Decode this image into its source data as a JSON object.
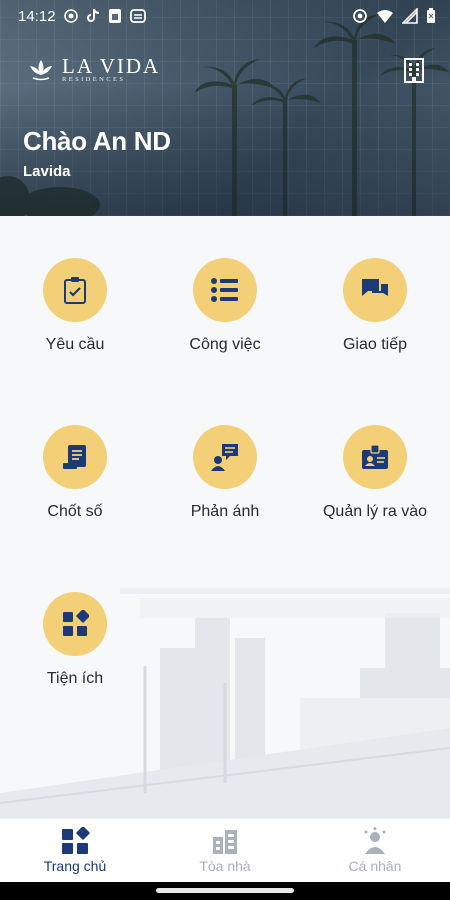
{
  "status_bar": {
    "time": "14:12",
    "left_icons": [
      "record-icon",
      "tiktok-icon",
      "sim-card-icon",
      "cast-icon"
    ],
    "right_icons": [
      "eye-icon",
      "wifi-icon",
      "signal-icon",
      "battery-icon"
    ]
  },
  "header": {
    "logo_text": "LA VIDA",
    "logo_subtext": "RESIDENCES",
    "greeting": "Chào An ND",
    "project_name": "Lavida",
    "building_icon": "building-icon"
  },
  "menu": {
    "items": [
      {
        "label": "Yêu cầu",
        "icon": "clipboard-check-icon"
      },
      {
        "label": "Công việc",
        "icon": "task-list-icon"
      },
      {
        "label": "Giao tiếp",
        "icon": "chat-bubbles-icon"
      },
      {
        "label": "Chốt số",
        "icon": "meter-bill-icon"
      },
      {
        "label": "Phản ánh",
        "icon": "feedback-person-icon"
      },
      {
        "label": "Quản lý ra vào",
        "icon": "id-badge-icon"
      },
      {
        "label": "Tiện ích",
        "icon": "utilities-grid-icon"
      }
    ]
  },
  "bottom_nav": {
    "items": [
      {
        "label": "Trang chủ",
        "icon": "home-grid-icon",
        "active": true
      },
      {
        "label": "Tòa nhà",
        "icon": "building-icon",
        "active": false
      },
      {
        "label": "Cá nhân",
        "icon": "person-icon",
        "active": false
      }
    ]
  },
  "colors": {
    "accent_yellow": "#f3cf78",
    "icon_navy": "#1b3a77",
    "inactive_gray": "#a9b1bc",
    "background": "#f7f8fa"
  }
}
